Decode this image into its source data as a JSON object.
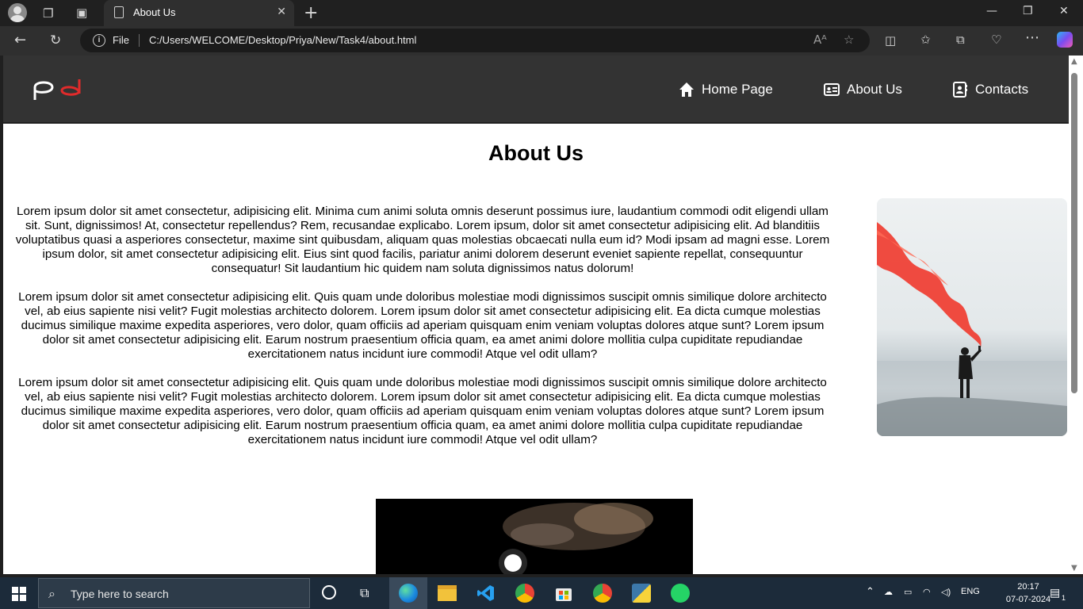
{
  "browser": {
    "tab_title": "About Us",
    "omnibox_scheme": "File",
    "url": "C:/Users/WELCOME/Desktop/Priya/New/Task4/about.html"
  },
  "nav": {
    "links": [
      "Home Page",
      "About Us",
      "Contacts"
    ]
  },
  "page": {
    "title": "About Us",
    "paragraphs": [
      "Lorem ipsum dolor sit amet consectetur, adipisicing elit. Minima cum animi soluta omnis deserunt possimus iure, laudantium commodi odit eligendi ullam sit. Sunt, dignissimos! At, consectetur repellendus? Rem, recusandae explicabo. Lorem ipsum, dolor sit amet consectetur adipisicing elit. Ad blanditiis voluptatibus quasi a asperiores consectetur, maxime sint quibusdam, aliquam quas molestias obcaecati nulla eum id? Modi ipsam ad magni esse. Lorem ipsum dolor, sit amet consectetur adipisicing elit. Eius sint quod facilis, pariatur animi dolorem deserunt eveniet sapiente repellat, consequuntur consequatur! Sit laudantium hic quidem nam soluta dignissimos natus dolorum!",
      "Lorem ipsum dolor sit amet consectetur adipisicing elit. Quis quam unde doloribus molestiae modi dignissimos suscipit omnis similique dolore architecto vel, ab eius sapiente nisi velit? Fugit molestias architecto dolorem. Lorem ipsum dolor sit amet consectetur adipisicing elit. Ea dicta cumque molestias ducimus similique maxime expedita asperiores, vero dolor, quam officiis ad aperiam quisquam enim veniam voluptas dolores atque sunt? Lorem ipsum dolor sit amet consectetur adipisicing elit. Earum nostrum praesentium officia quam, ea amet animi dolore mollitia culpa cupiditate repudiandae exercitationem natus incidunt iure commodi! Atque vel odit ullam?",
      "Lorem ipsum dolor sit amet consectetur adipisicing elit. Quis quam unde doloribus molestiae modi dignissimos suscipit omnis similique dolore architecto vel, ab eius sapiente nisi velit? Fugit molestias architecto dolorem. Lorem ipsum dolor sit amet consectetur adipisicing elit. Ea dicta cumque molestias ducimus similique maxime expedita asperiores, vero dolor, quam officiis ad aperiam quisquam enim veniam voluptas dolores atque sunt? Lorem ipsum dolor sit amet consectetur adipisicing elit. Earum nostrum praesentium officia quam, ea amet animi dolore mollitia culpa cupiditate repudiandae exercitationem natus incidunt iure commodi! Atque vel odit ullam?"
    ]
  },
  "taskbar": {
    "search_placeholder": "Type here to search",
    "language": "ENG",
    "time": "20:17",
    "date": "07-07-2024",
    "notification_count": "1"
  },
  "colors": {
    "navbar_bg": "#333333",
    "logo_accent": "#e02b2b",
    "smoke": "#f0382c"
  }
}
